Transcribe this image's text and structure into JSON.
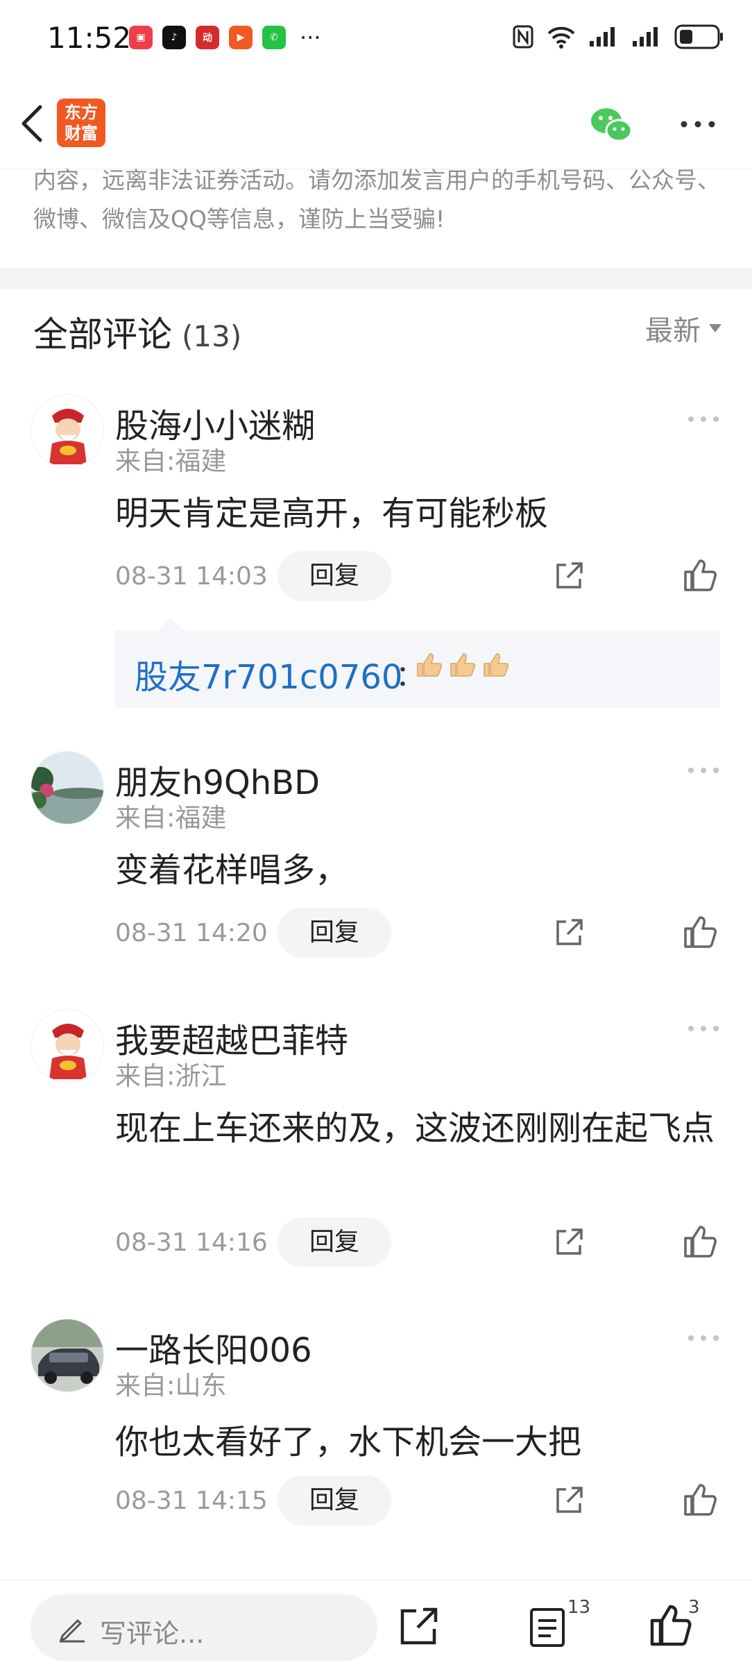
{
  "status_bar": {
    "time": "11:52",
    "apps": [
      {
        "name": "shopping-app-icon",
        "color": "#ef3e4a",
        "glyph": "▣"
      },
      {
        "name": "tiktok-icon",
        "color": "#111111",
        "glyph": "♪"
      },
      {
        "name": "news-app-icon",
        "color": "#d62b2b",
        "glyph": "动"
      },
      {
        "name": "video-app-icon",
        "color": "#f05a22",
        "glyph": "▶"
      },
      {
        "name": "wechat-app-icon",
        "color": "#23c343",
        "glyph": "✆"
      }
    ],
    "more": "···"
  },
  "header": {
    "logo_line1": "东方",
    "logo_line2": "财富",
    "logo_color": "#f05a22"
  },
  "disclaimer": "内容，远离非法证券活动。请勿添加发言用户的手机号码、公众号、微博、微信及QQ等信息，谨防上当受骗!",
  "section": {
    "title": "全部评论",
    "count": "(13)",
    "sort_label": "最新"
  },
  "comments": [
    {
      "username": "股海小小迷糊",
      "location": "来自:福建",
      "text": "明天肯定是高开，有可能秒板",
      "timestamp": "08-31 14:03",
      "reply_label": "回复",
      "reply": {
        "user": "股友7r701c0760",
        "colon": "：",
        "emojis": "👍👍👍"
      }
    },
    {
      "username": "朋友h9QhBD",
      "location": "来自:福建",
      "text": "变着花样唱多，",
      "timestamp": "08-31 14:20",
      "reply_label": "回复"
    },
    {
      "username": "我要超越巴菲特",
      "location": "来自:浙江",
      "text": "现在上车还来的及，这波还刚刚在起飞点",
      "timestamp": "08-31 14:16",
      "reply_label": "回复"
    },
    {
      "username": "一路长阳006",
      "location": "来自:山东",
      "text": "你也太看好了，水下机会一大把",
      "timestamp": "08-31 14:15",
      "reply_label": "回复"
    }
  ],
  "bottom_bar": {
    "input_placeholder": "写评论...",
    "comment_count": "13",
    "like_count": "3"
  }
}
